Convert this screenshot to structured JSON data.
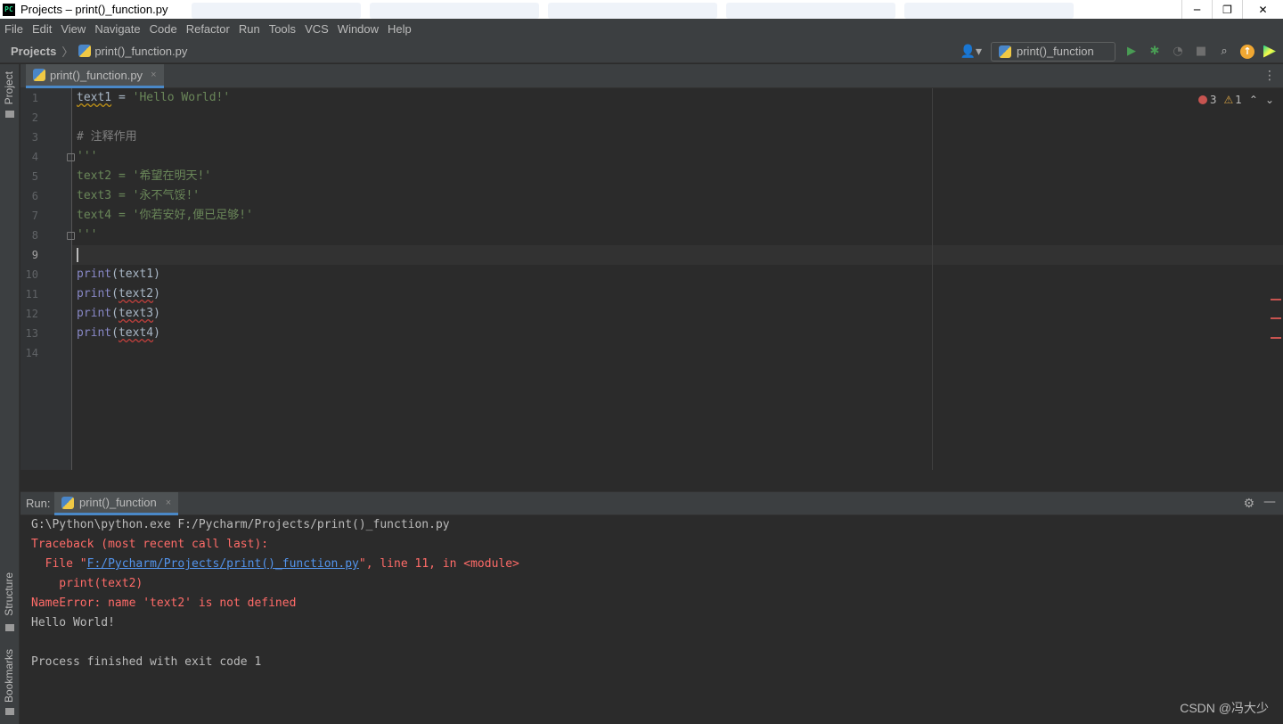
{
  "window": {
    "app_icon_text": "PC",
    "title": "Projects – print()_function.py",
    "controls": [
      "─",
      "❐",
      "✕"
    ]
  },
  "menu": [
    "File",
    "Edit",
    "View",
    "Navigate",
    "Code",
    "Refactor",
    "Run",
    "Tools",
    "VCS",
    "Window",
    "Help"
  ],
  "breadcrumb": {
    "root": "Projects",
    "separator": "〉",
    "file": "print()_function.py"
  },
  "toolbar": {
    "run_config": "print()_function",
    "icons": [
      "user-icon",
      "run-icon",
      "debug-icon",
      "coverage-icon",
      "stop-icon",
      "search-icon",
      "update-icon",
      "pycharm-logo-icon"
    ]
  },
  "left_strip": {
    "project": "Project",
    "structure": "Structure",
    "bookmarks": "Bookmarks"
  },
  "editor_tab": {
    "label": "print()_function.py",
    "close": "×"
  },
  "editor": {
    "inspections": {
      "errors": "3",
      "warnings": "1",
      "warning_symbol": "⚠",
      "up": "⌃",
      "down": "⌄"
    },
    "current_line": 9,
    "lines": [
      {
        "n": "1",
        "var": "text1",
        "op": " = ",
        "str": "'Hello World!'"
      },
      {
        "n": "2"
      },
      {
        "n": "3",
        "comment": "# 注释作用"
      },
      {
        "n": "4",
        "str": "'''"
      },
      {
        "n": "5",
        "str": "text2 = '希望在明天!'"
      },
      {
        "n": "6",
        "str": "text3 = '永不气馁!'"
      },
      {
        "n": "7",
        "str": "text4 = '你若安好,便已足够!'"
      },
      {
        "n": "8",
        "str": "'''"
      },
      {
        "n": "9"
      },
      {
        "n": "10",
        "fn": "print",
        "open": "(",
        "arg": "text1",
        "close": ")"
      },
      {
        "n": "11",
        "fn": "print",
        "open": "(",
        "arg": "text2",
        "close": ")"
      },
      {
        "n": "12",
        "fn": "print",
        "open": "(",
        "arg": "text3",
        "close": ")"
      },
      {
        "n": "13",
        "fn": "print",
        "open": "(",
        "arg": "text4",
        "close": ")"
      },
      {
        "n": "14"
      }
    ]
  },
  "run_panel": {
    "label": "Run:",
    "tab": "print()_function",
    "close": "×",
    "gear": "⚙",
    "minimize": "—"
  },
  "console": {
    "cmd": "G:\\Python\\python.exe F:/Pycharm/Projects/print()_function.py",
    "tb_header": "Traceback (most recent call last):",
    "file_prefix": "  File \"",
    "file_link": "F:/Pycharm/Projects/print()_function.py",
    "file_suffix": "\", line 11, in <module>",
    "code_line": "    print(text2)",
    "error": "NameError: name 'text2' is not defined",
    "output": "Hello World!",
    "finished": "Process finished with exit code 1"
  },
  "watermark": "CSDN @冯大少",
  "colors": {
    "editor_bg": "#2b2b2b",
    "chrome_bg": "#3c3f41",
    "string": "#6a8759",
    "keyword_fn": "#8888c6",
    "error": "#ff6b68",
    "link": "#5394ec"
  }
}
